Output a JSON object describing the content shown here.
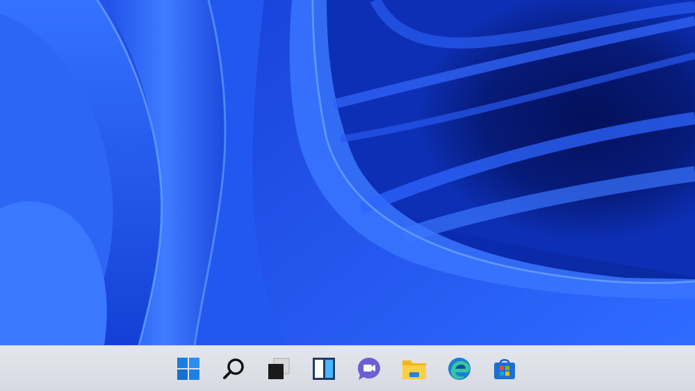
{
  "desktop": {
    "wallpaper": "windows-11-bloom-wallpaper",
    "colors": {
      "deep": "#061a78",
      "mid": "#1746e6",
      "light": "#3f7cff",
      "highlight": "#6fa6ff"
    }
  },
  "taskbar": {
    "background": "#dfe2e8",
    "items": [
      {
        "name": "start-button",
        "icon": "windows-logo-icon"
      },
      {
        "name": "search-button",
        "icon": "search-icon"
      },
      {
        "name": "task-view-button",
        "icon": "task-view-icon"
      },
      {
        "name": "widgets-button",
        "icon": "widgets-icon"
      },
      {
        "name": "teams-chat-button",
        "icon": "teams-chat-icon"
      },
      {
        "name": "file-explorer-button",
        "icon": "folder-icon"
      },
      {
        "name": "edge-button",
        "icon": "edge-icon"
      },
      {
        "name": "microsoft-store-button",
        "icon": "store-icon"
      }
    ]
  }
}
